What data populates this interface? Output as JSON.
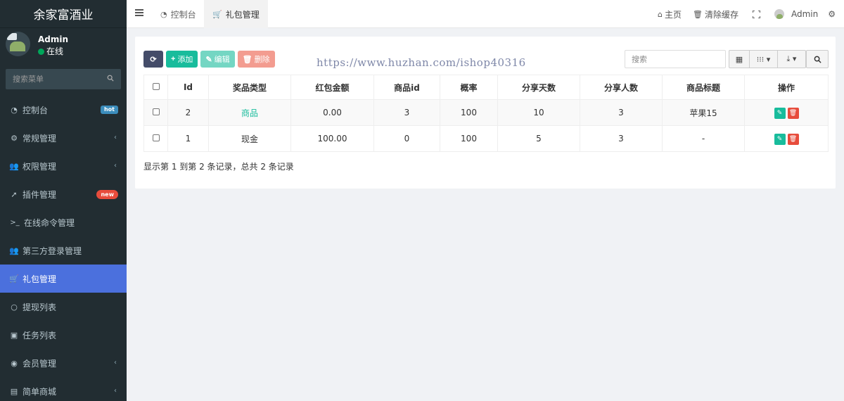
{
  "brand": "余家富酒业",
  "user": {
    "name": "Admin",
    "status": "在线"
  },
  "sidebar_search": {
    "placeholder": "搜索菜单"
  },
  "menu": [
    {
      "label": "控制台",
      "icon": "dashboard-icon",
      "glyph": "◔",
      "badge": "hot"
    },
    {
      "label": "常规管理",
      "icon": "cogs-icon",
      "glyph": "⚙",
      "chevron": "‹"
    },
    {
      "label": "权限管理",
      "icon": "group-icon",
      "glyph": "👥",
      "chevron": "‹"
    },
    {
      "label": "插件管理",
      "icon": "rocket-icon",
      "glyph": "➚",
      "badge": "new"
    },
    {
      "label": "在线命令管理",
      "icon": "terminal-icon",
      "glyph": ">_"
    },
    {
      "label": "第三方登录管理",
      "icon": "group-icon",
      "glyph": "👥"
    },
    {
      "label": "礼包管理",
      "icon": "cart-icon",
      "glyph": "🛒",
      "active": true
    },
    {
      "label": "提现列表",
      "icon": "circle-icon",
      "glyph": "○"
    },
    {
      "label": "任务列表",
      "icon": "archive-icon",
      "glyph": "▣"
    },
    {
      "label": "会员管理",
      "icon": "user-circle-icon",
      "glyph": "◉",
      "chevron": "‹"
    },
    {
      "label": "简单商城",
      "icon": "shopping-bag-icon",
      "glyph": "▤",
      "chevron": "‹"
    }
  ],
  "header": {
    "tabs": [
      {
        "label": "控制台",
        "glyph": "◔"
      },
      {
        "label": "礼包管理",
        "glyph": "🛒"
      }
    ],
    "right": {
      "home": "主页",
      "clear_cache": "清除缓存",
      "admin": "Admin"
    }
  },
  "toolbar": {
    "add": "添加",
    "edit": "编辑",
    "delete": "删除"
  },
  "watermark": "https://www.huzhan.com/ishop40316",
  "table_search": {
    "placeholder": "搜索"
  },
  "table": {
    "columns": [
      "Id",
      "奖品类型",
      "红包金额",
      "商品id",
      "概率",
      "分享天数",
      "分享人数",
      "商品标题",
      "操作"
    ],
    "rows": [
      {
        "id": "2",
        "type": "商品",
        "amount": "0.00",
        "goods_id": "3",
        "rate": "100",
        "share_days": "10",
        "share_users": "3",
        "title": "苹果15"
      },
      {
        "id": "1",
        "type": "现金",
        "amount": "100.00",
        "goods_id": "0",
        "rate": "100",
        "share_days": "5",
        "share_users": "3",
        "title": "-"
      }
    ]
  },
  "pagination_info": "显示第 1 到第 2 条记录，总共 2 条记录",
  "colors": {
    "sidebar_bg": "#222d32",
    "active_menu": "#4b70dd",
    "success": "#18bc9c",
    "danger": "#e74c3c"
  }
}
